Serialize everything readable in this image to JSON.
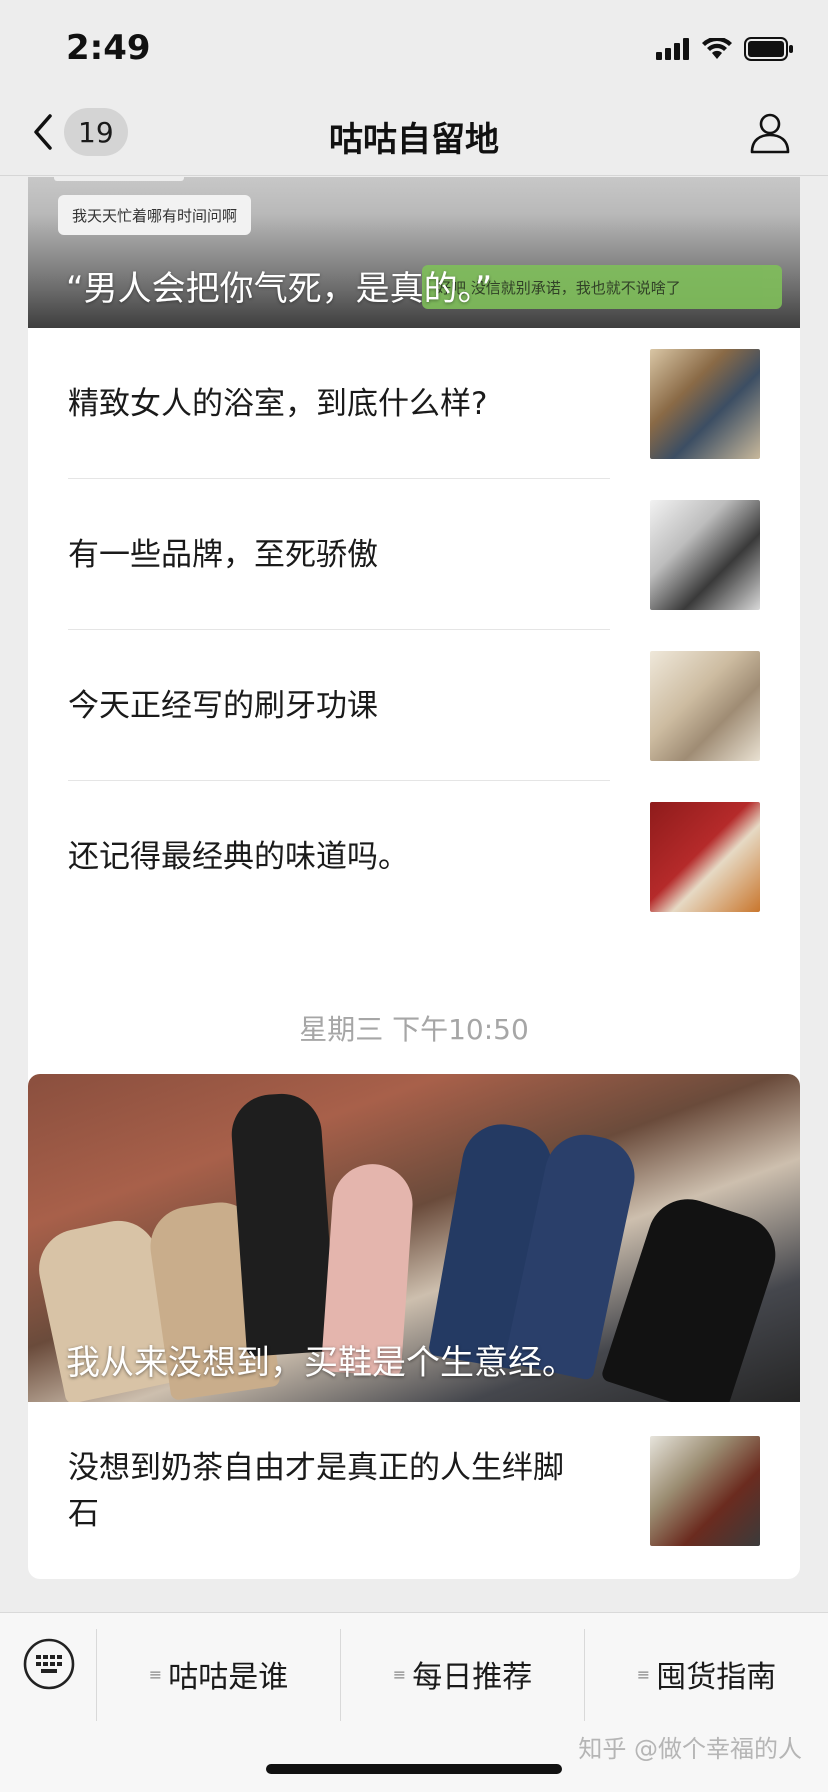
{
  "status_bar": {
    "time": "2:49"
  },
  "nav": {
    "badge": "19",
    "title": "咕咕自留地"
  },
  "featured": {
    "chat_bubble": "我天天忙着哪有时间问啊",
    "chat_green": "好吧 没信就别承诺，我也就不说啥了",
    "caption": "“男人会把你气死，是真的。”"
  },
  "articles": [
    {
      "title": "精致女人的浴室，到底什么样?"
    },
    {
      "title": "有一些品牌，至死骄傲"
    },
    {
      "title": "今天正经写的刷牙功课"
    },
    {
      "title": "还记得最经典的味道吗。"
    }
  ],
  "timestamp": "星期三 下午10:50",
  "featured2": {
    "caption": "我从来没想到，买鞋是个生意经。"
  },
  "articles2": [
    {
      "title": "没想到奶茶自由才是真正的人生绊脚石"
    }
  ],
  "bottom_menu": {
    "items": [
      {
        "label": "咕咕是谁"
      },
      {
        "label": "每日推荐"
      },
      {
        "label": "囤货指南"
      }
    ],
    "watermark": "知乎 @做个幸福的人"
  },
  "colors": {
    "background": "#ededed",
    "card": "#ffffff",
    "timestamp": "#a6a6a6"
  }
}
